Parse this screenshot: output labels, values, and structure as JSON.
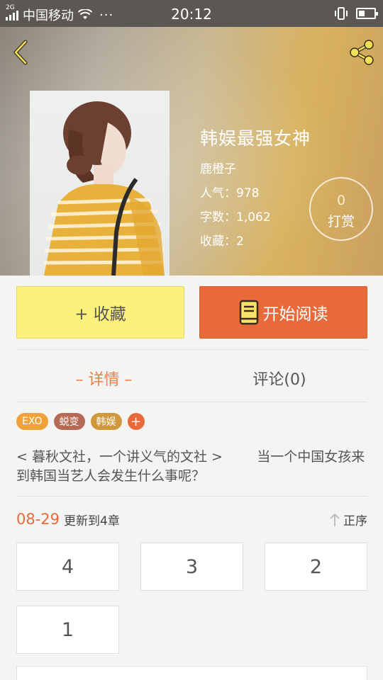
{
  "status_bar": {
    "network_badge": "2G",
    "carrier": "中国移动",
    "dots": "···",
    "time": "20:12"
  },
  "book": {
    "title": "韩娱最强女神",
    "author": "鹿橙子",
    "popularity": "人气：978",
    "word_count": "字数：1,062",
    "favorites": "收藏：2"
  },
  "tip": {
    "count": "0",
    "label": "打赏"
  },
  "actions": {
    "favorite_label": "+ 收藏",
    "read_label": "开始阅读"
  },
  "tabs": {
    "detail": "– 详情 –",
    "comments": "评论(0)"
  },
  "tags": [
    {
      "label": "EXO",
      "color": "#f0a23a"
    },
    {
      "label": "蜕变",
      "color": "#b66a55"
    },
    {
      "label": "韩娱",
      "color": "#d0983c"
    }
  ],
  "tag_add": "+",
  "description": "< 暮秋文社，一个讲义气的文社 >        当一个中国女孩来到韩国当艺人会发生什么事呢？",
  "update": {
    "date": "08-29",
    "text": "更新到4章"
  },
  "sort_label": "正序",
  "chapters": [
    "4",
    "3",
    "2",
    "1"
  ],
  "colors": {
    "accent": "#e86a3a",
    "favorite_button": "#fdf17e"
  }
}
